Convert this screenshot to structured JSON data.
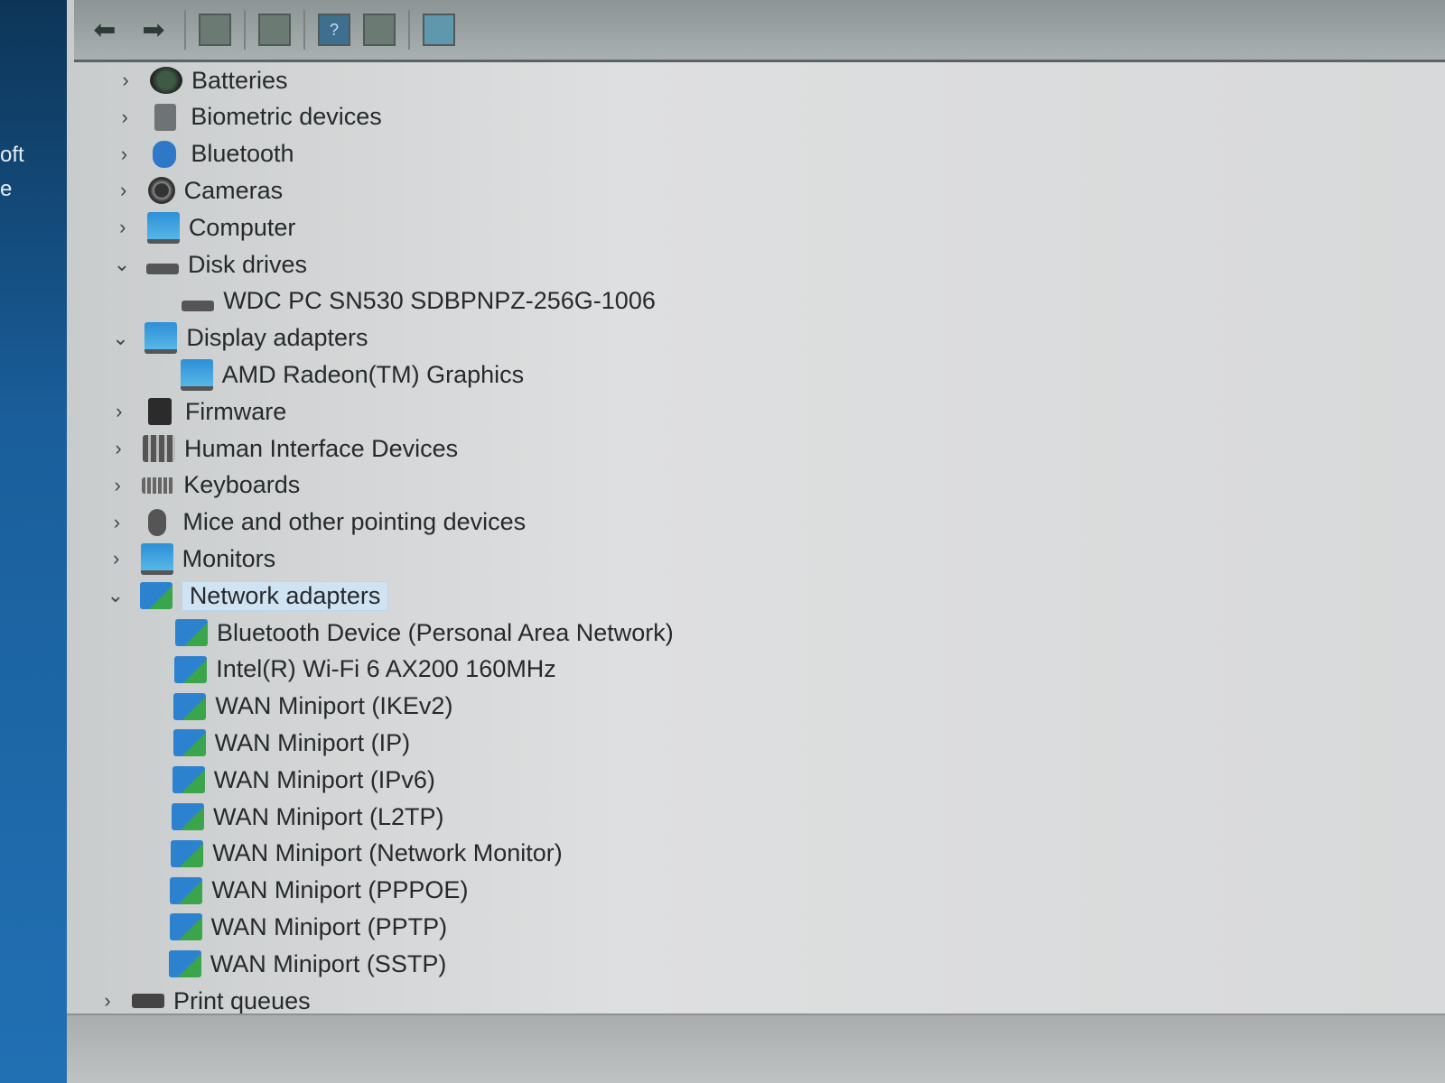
{
  "desktop": {
    "labels": [
      "oft",
      "e"
    ]
  },
  "toolbar": {
    "buttons": [
      {
        "name": "back-button",
        "icon": "arrow-left-icon"
      },
      {
        "name": "forward-button",
        "icon": "arrow-right-icon"
      },
      {
        "name": "show-hide-console-tree-button",
        "icon": "console-tree-icon"
      },
      {
        "name": "properties-button",
        "icon": "properties-icon"
      },
      {
        "name": "help-button",
        "icon": "help-icon",
        "glyph": "?"
      },
      {
        "name": "action-pane-button",
        "icon": "action-pane-icon"
      },
      {
        "name": "scan-hardware-button",
        "icon": "monitor-scan-icon"
      }
    ]
  },
  "tree": [
    {
      "label": "Batteries",
      "level": 0,
      "state": "collapsed",
      "icon": "battery-icon"
    },
    {
      "label": "Biometric devices",
      "level": 0,
      "state": "collapsed",
      "icon": "biometric-icon"
    },
    {
      "label": "Bluetooth",
      "level": 0,
      "state": "collapsed",
      "icon": "bluetooth-icon"
    },
    {
      "label": "Cameras",
      "level": 0,
      "state": "collapsed",
      "icon": "camera-icon"
    },
    {
      "label": "Computer",
      "level": 0,
      "state": "collapsed",
      "icon": "computer-icon"
    },
    {
      "label": "Disk drives",
      "level": 0,
      "state": "expanded",
      "icon": "disk-drive-icon"
    },
    {
      "label": "WDC PC SN530 SDBPNPZ-256G-1006",
      "level": 1,
      "icon": "disk-drive-icon"
    },
    {
      "label": "Display adapters",
      "level": 0,
      "state": "expanded",
      "icon": "display-adapter-icon"
    },
    {
      "label": "AMD Radeon(TM) Graphics",
      "level": 1,
      "icon": "display-adapter-icon"
    },
    {
      "label": "Firmware",
      "level": 0,
      "state": "collapsed",
      "icon": "firmware-icon"
    },
    {
      "label": "Human Interface Devices",
      "level": 0,
      "state": "collapsed",
      "icon": "hid-icon"
    },
    {
      "label": "Keyboards",
      "level": 0,
      "state": "collapsed",
      "icon": "keyboard-icon"
    },
    {
      "label": "Mice and other pointing devices",
      "level": 0,
      "state": "collapsed",
      "icon": "mouse-icon"
    },
    {
      "label": "Monitors",
      "level": 0,
      "state": "collapsed",
      "icon": "monitor-icon"
    },
    {
      "label": "Network adapters",
      "level": 0,
      "state": "expanded",
      "icon": "network-adapter-icon",
      "selected": true
    },
    {
      "label": "Bluetooth Device (Personal Area Network)",
      "level": 1,
      "icon": "network-adapter-icon"
    },
    {
      "label": "Intel(R) Wi-Fi 6 AX200 160MHz",
      "level": 1,
      "icon": "network-adapter-icon"
    },
    {
      "label": "WAN Miniport (IKEv2)",
      "level": 1,
      "icon": "network-adapter-icon"
    },
    {
      "label": "WAN Miniport (IP)",
      "level": 1,
      "icon": "network-adapter-icon"
    },
    {
      "label": "WAN Miniport (IPv6)",
      "level": 1,
      "icon": "network-adapter-icon"
    },
    {
      "label": "WAN Miniport (L2TP)",
      "level": 1,
      "icon": "network-adapter-icon"
    },
    {
      "label": "WAN Miniport (Network Monitor)",
      "level": 1,
      "icon": "network-adapter-icon"
    },
    {
      "label": "WAN Miniport (PPPOE)",
      "level": 1,
      "icon": "network-adapter-icon"
    },
    {
      "label": "WAN Miniport (PPTP)",
      "level": 1,
      "icon": "network-adapter-icon"
    },
    {
      "label": "WAN Miniport (SSTP)",
      "level": 1,
      "icon": "network-adapter-icon"
    },
    {
      "label": "Print queues",
      "level": 0,
      "state": "collapsed",
      "icon": "printer-icon"
    }
  ]
}
